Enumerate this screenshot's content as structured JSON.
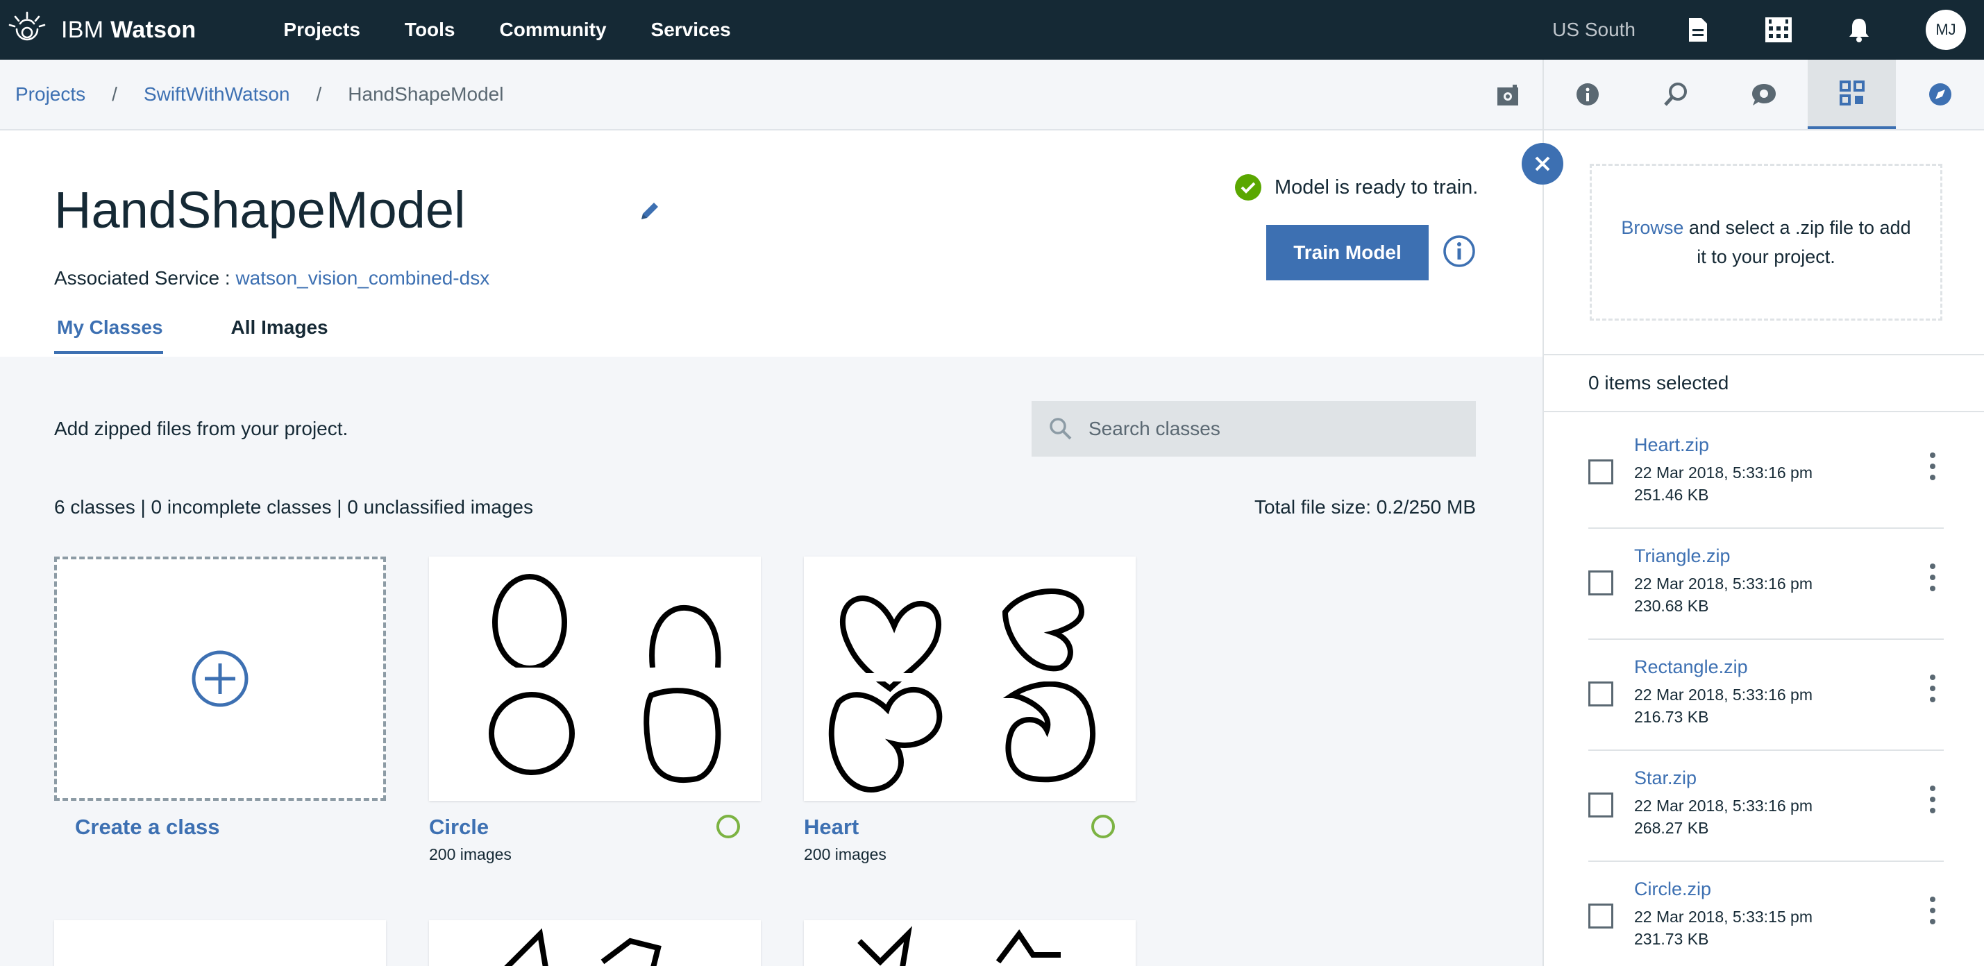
{
  "brand": {
    "prefix": "IBM",
    "name": "Watson"
  },
  "nav": {
    "items": [
      "Projects",
      "Tools",
      "Community",
      "Services"
    ]
  },
  "topbar": {
    "region": "US South",
    "avatar_initials": "MJ",
    "icons": [
      "document-icon",
      "apps-grid-icon",
      "notification-bell-icon"
    ]
  },
  "breadcrumb": {
    "items": [
      "Projects",
      "SwiftWithWatson"
    ],
    "current": "HandShapeModel",
    "separator": "/"
  },
  "header": {
    "title": "HandShapeModel",
    "associated_label": "Associated Service :",
    "associated_service": "watson_vision_combined-dsx",
    "status": "Model is ready to train.",
    "train_button": "Train Model"
  },
  "tabs": [
    {
      "label": "My Classes",
      "active": true
    },
    {
      "label": "All Images",
      "active": false
    }
  ],
  "classes_area": {
    "instruction": "Add zipped files from your project.",
    "search_placeholder": "Search classes",
    "counts": "6 classes | 0 incomplete classes | 0 unclassified images",
    "file_size": "Total file size: 0.2/250 MB",
    "create_label": "Create a class",
    "cards": [
      {
        "name": "Circle",
        "images": "200 images"
      },
      {
        "name": "Heart",
        "images": "200 images"
      }
    ]
  },
  "panel": {
    "tabs": [
      "info-icon",
      "data-search-icon",
      "chat-icon",
      "data-assets-icon",
      "compass-icon"
    ],
    "active_tab": 3,
    "browse_link": "Browse",
    "browse_text": " and select a .zip file to add it to your project.",
    "selected": "0 items selected",
    "files": [
      {
        "name": "Heart.zip",
        "date": "22 Mar 2018, 5:33:16 pm",
        "size": "251.46 KB"
      },
      {
        "name": "Triangle.zip",
        "date": "22 Mar 2018, 5:33:16 pm",
        "size": "230.68 KB"
      },
      {
        "name": "Rectangle.zip",
        "date": "22 Mar 2018, 5:33:16 pm",
        "size": "216.73 KB"
      },
      {
        "name": "Star.zip",
        "date": "22 Mar 2018, 5:33:16 pm",
        "size": "268.27 KB"
      },
      {
        "name": "Circle.zip",
        "date": "22 Mar 2018, 5:33:15 pm",
        "size": "231.73 KB"
      }
    ]
  },
  "colors": {
    "nav_bg": "#152935",
    "accent": "#3d70b2",
    "success": "#5aa700",
    "ring": "#7cb343"
  }
}
